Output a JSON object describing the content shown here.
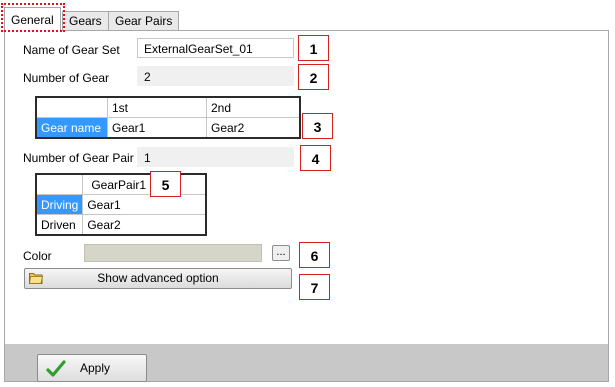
{
  "tabs": [
    {
      "label": "General",
      "active": true
    },
    {
      "label": "Gears",
      "active": false
    },
    {
      "label": "Gear Pairs",
      "active": false
    }
  ],
  "gear_set_name": {
    "label": "Name of Gear Set",
    "value": "ExternalGearSet_01"
  },
  "number_of_gear": {
    "label": "Number of Gear",
    "value": "2"
  },
  "gear_table": {
    "columns": [
      "",
      "1st",
      "2nd"
    ],
    "rows": [
      {
        "header": "Gear name",
        "cells": [
          "Gear1",
          "Gear2"
        ]
      }
    ]
  },
  "number_of_gear_pair": {
    "label": "Number of Gear Pair",
    "value": "1"
  },
  "pair_table": {
    "columns": [
      "",
      "GearPair1"
    ],
    "rows": [
      {
        "header": "Driving",
        "cells": [
          "Gear1"
        ]
      },
      {
        "header": "Driven",
        "cells": [
          "Gear2"
        ]
      }
    ]
  },
  "color": {
    "label": "Color",
    "swatch": "#d6d6c8",
    "browse_label": "..."
  },
  "advanced_button": {
    "label": "Show advanced option",
    "icon": "folder-icon"
  },
  "apply_button": {
    "label": "Apply",
    "icon": "checkmark-icon"
  },
  "callouts": [
    "1",
    "2",
    "3",
    "4",
    "5",
    "6",
    "7"
  ],
  "colors": {
    "accent_selection": "#3399ff",
    "callout_border": "#d62121",
    "bottom_bar": "#c8c8c8"
  }
}
